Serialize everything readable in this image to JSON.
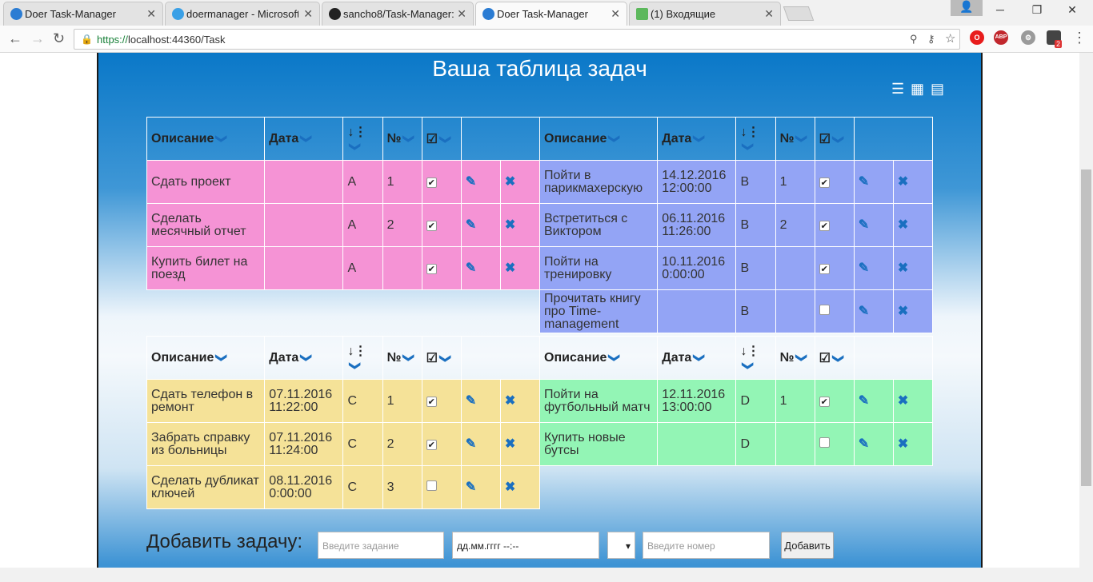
{
  "browser": {
    "tabs": [
      {
        "label": "Doer Task-Manager",
        "icon": "check-shield-icon",
        "color": "#2b7cd3"
      },
      {
        "label": "doermanager - Microsoft",
        "icon": "cloud-icon",
        "color": "#3aa0e6"
      },
      {
        "label": "sancho8/Task-Manager:",
        "icon": "github-icon",
        "color": "#222222"
      },
      {
        "label": "Doer Task-Manager",
        "icon": "check-shield-icon",
        "color": "#2b7cd3"
      },
      {
        "label": "(1) Входящие",
        "icon": "mail-icon",
        "color": "#5cb85c"
      }
    ],
    "url_scheme": "https://",
    "url_rest": "localhost:44360/Task",
    "ext_abp": "ABP",
    "ext_badge": "2"
  },
  "page": {
    "title": "Ваша таблица задач"
  },
  "quadrants": [
    {
      "color": "#f593d5",
      "headers": [
        "Описание",
        "Дата",
        "",
        "№",
        ""
      ],
      "rows": [
        {
          "desc": "Сдать проект",
          "date": "",
          "priority": "A",
          "num": "1",
          "done": true
        },
        {
          "desc": "Сделать месячный отчет",
          "date": "",
          "priority": "A",
          "num": "2",
          "done": true
        },
        {
          "desc": "Купить билет на поезд",
          "date": "",
          "priority": "A",
          "num": "",
          "done": true
        }
      ]
    },
    {
      "color": "#93a4f5",
      "headers": [
        "Описание",
        "Дата",
        "",
        "№",
        ""
      ],
      "rows": [
        {
          "desc": "Пойти в парикмахерскую",
          "date": "14.12.2016 12:00:00",
          "priority": "B",
          "num": "1",
          "done": true
        },
        {
          "desc": "Встретиться с Виктором",
          "date": "06.11.2016 11:26:00",
          "priority": "B",
          "num": "2",
          "done": true
        },
        {
          "desc": "Пойти на тренировку",
          "date": "10.11.2016 0:00:00",
          "priority": "B",
          "num": "",
          "done": true
        },
        {
          "desc": "Прочитать книгу про Time-management",
          "date": "",
          "priority": "B",
          "num": "",
          "done": false
        }
      ]
    },
    {
      "color": "#f5e298",
      "headers": [
        "Описание",
        "Дата",
        "",
        "№",
        ""
      ],
      "rows": [
        {
          "desc": "Сдать телефон в ремонт",
          "date": "07.11.2016 11:22:00",
          "priority": "C",
          "num": "1",
          "done": true
        },
        {
          "desc": "Забрать справку из больницы",
          "date": "07.11.2016 11:24:00",
          "priority": "C",
          "num": "2",
          "done": true
        },
        {
          "desc": "Сделать дубликат ключей",
          "date": "08.11.2016 0:00:00",
          "priority": "C",
          "num": "3",
          "done": false
        }
      ]
    },
    {
      "color": "#93f5b5",
      "headers": [
        "Описание",
        "Дата",
        "",
        "№",
        ""
      ],
      "rows": [
        {
          "desc": "Пойти на футбольный матч",
          "date": "12.11.2016 13:00:00",
          "priority": "D",
          "num": "1",
          "done": true
        },
        {
          "desc": "Купить новые бутсы",
          "date": "",
          "priority": "D",
          "num": "",
          "done": false
        }
      ]
    }
  ],
  "add_form": {
    "label": "Добавить задачу:",
    "task_placeholder": "Введите задание",
    "date_value": "дд.мм.гггг --:--",
    "number_placeholder": "Введите номер",
    "button_label": "Добавить"
  }
}
